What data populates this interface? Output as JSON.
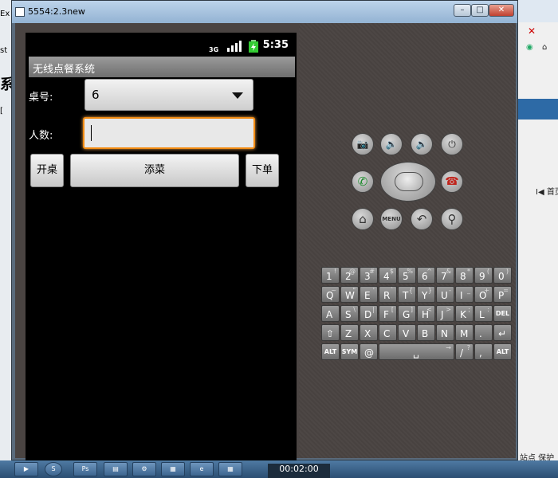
{
  "window": {
    "title": "5554:2.3new",
    "controls": [
      "–",
      "□",
      "✕"
    ]
  },
  "background": {
    "left_snips": [
      "Ex",
      "st",
      "系",
      "["
    ],
    "right_snips": [
      "✕",
      "⌂",
      "◉",
      "I◀ 首页",
      "站点 保护"
    ]
  },
  "status_bar": {
    "network": "3G",
    "time": "5:35"
  },
  "app": {
    "title": "无线点餐系统",
    "table_label": "桌号:",
    "table_value": "6",
    "people_label": "人数:",
    "people_value": "",
    "buttons": {
      "open_table": "开桌",
      "add_dish": "添菜",
      "place_order": "下单"
    }
  },
  "emulator_controls": {
    "camera": "📷",
    "vol_down": "🔉",
    "vol_up": "🔊",
    "power": "⏻",
    "call": "✆",
    "end_call": "☎",
    "home": "⌂",
    "menu": "MENU",
    "back": "↶",
    "search": "⚲"
  },
  "keyboard": {
    "row1": [
      [
        "1",
        "!"
      ],
      [
        "2",
        "@"
      ],
      [
        "3",
        "#"
      ],
      [
        "4",
        "$"
      ],
      [
        "5",
        "%"
      ],
      [
        "6",
        "^"
      ],
      [
        "7",
        "&"
      ],
      [
        "8",
        "*"
      ],
      [
        "9",
        "("
      ],
      [
        "0",
        ")"
      ]
    ],
    "row2": [
      [
        "Q",
        "~"
      ],
      [
        "W",
        "\""
      ],
      [
        "E",
        "'"
      ],
      [
        "R",
        "`"
      ],
      [
        "T",
        "{"
      ],
      [
        "Y",
        "}"
      ],
      [
        "U",
        "-"
      ],
      [
        "I",
        "_"
      ],
      [
        "O",
        "+"
      ],
      [
        "P",
        "="
      ]
    ],
    "row3": [
      [
        "A",
        ""
      ],
      [
        "S",
        "\\"
      ],
      [
        "D",
        "|"
      ],
      [
        "F",
        "["
      ],
      [
        "G",
        "]"
      ],
      [
        "H",
        "<"
      ],
      [
        "J",
        ">"
      ],
      [
        "K",
        ";"
      ],
      [
        "L",
        ":"
      ],
      [
        "DEL",
        ""
      ]
    ],
    "row4": [
      [
        "⇧",
        ""
      ],
      [
        "Z",
        ""
      ],
      [
        "X",
        ""
      ],
      [
        "C",
        ""
      ],
      [
        "V",
        ""
      ],
      [
        "B",
        ""
      ],
      [
        "N",
        ""
      ],
      [
        "M",
        ""
      ],
      [
        ".",
        ""
      ],
      [
        "↵",
        ""
      ]
    ],
    "row5": [
      [
        "ALT",
        ""
      ],
      [
        "SYM",
        ""
      ],
      [
        "@",
        ""
      ],
      [
        "␣",
        "→"
      ],
      [
        "/",
        "?"
      ],
      [
        ",",
        ""
      ],
      [
        "ALT",
        ""
      ]
    ]
  },
  "taskbar": {
    "items": [
      "▶",
      "S",
      "Ps",
      "▤",
      "⚙",
      "▦",
      "e",
      "▦"
    ],
    "clock": "00:02:00"
  }
}
